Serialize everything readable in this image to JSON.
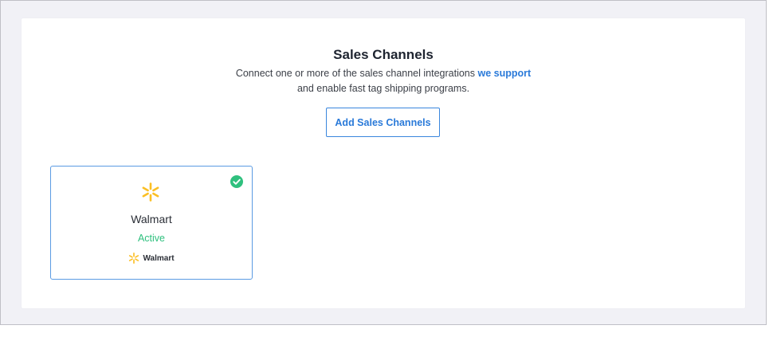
{
  "header": {
    "title": "Sales Channels",
    "subtitle_before_link": "Connect one or more of the sales channel integrations ",
    "subtitle_link": "we support",
    "subtitle_line2": "and enable fast tag shipping programs."
  },
  "actions": {
    "add_button_label": "Add Sales Channels"
  },
  "channels": [
    {
      "name": "Walmart",
      "status": "Active",
      "logo_text": "Walmart",
      "icon": "walmart-spark-icon",
      "badge_icon": "check-circle-icon"
    }
  ],
  "colors": {
    "accent": "#2a7ad9",
    "active": "#2fc07e",
    "spark": "#fbbf24",
    "background": "#f1f1f6"
  }
}
